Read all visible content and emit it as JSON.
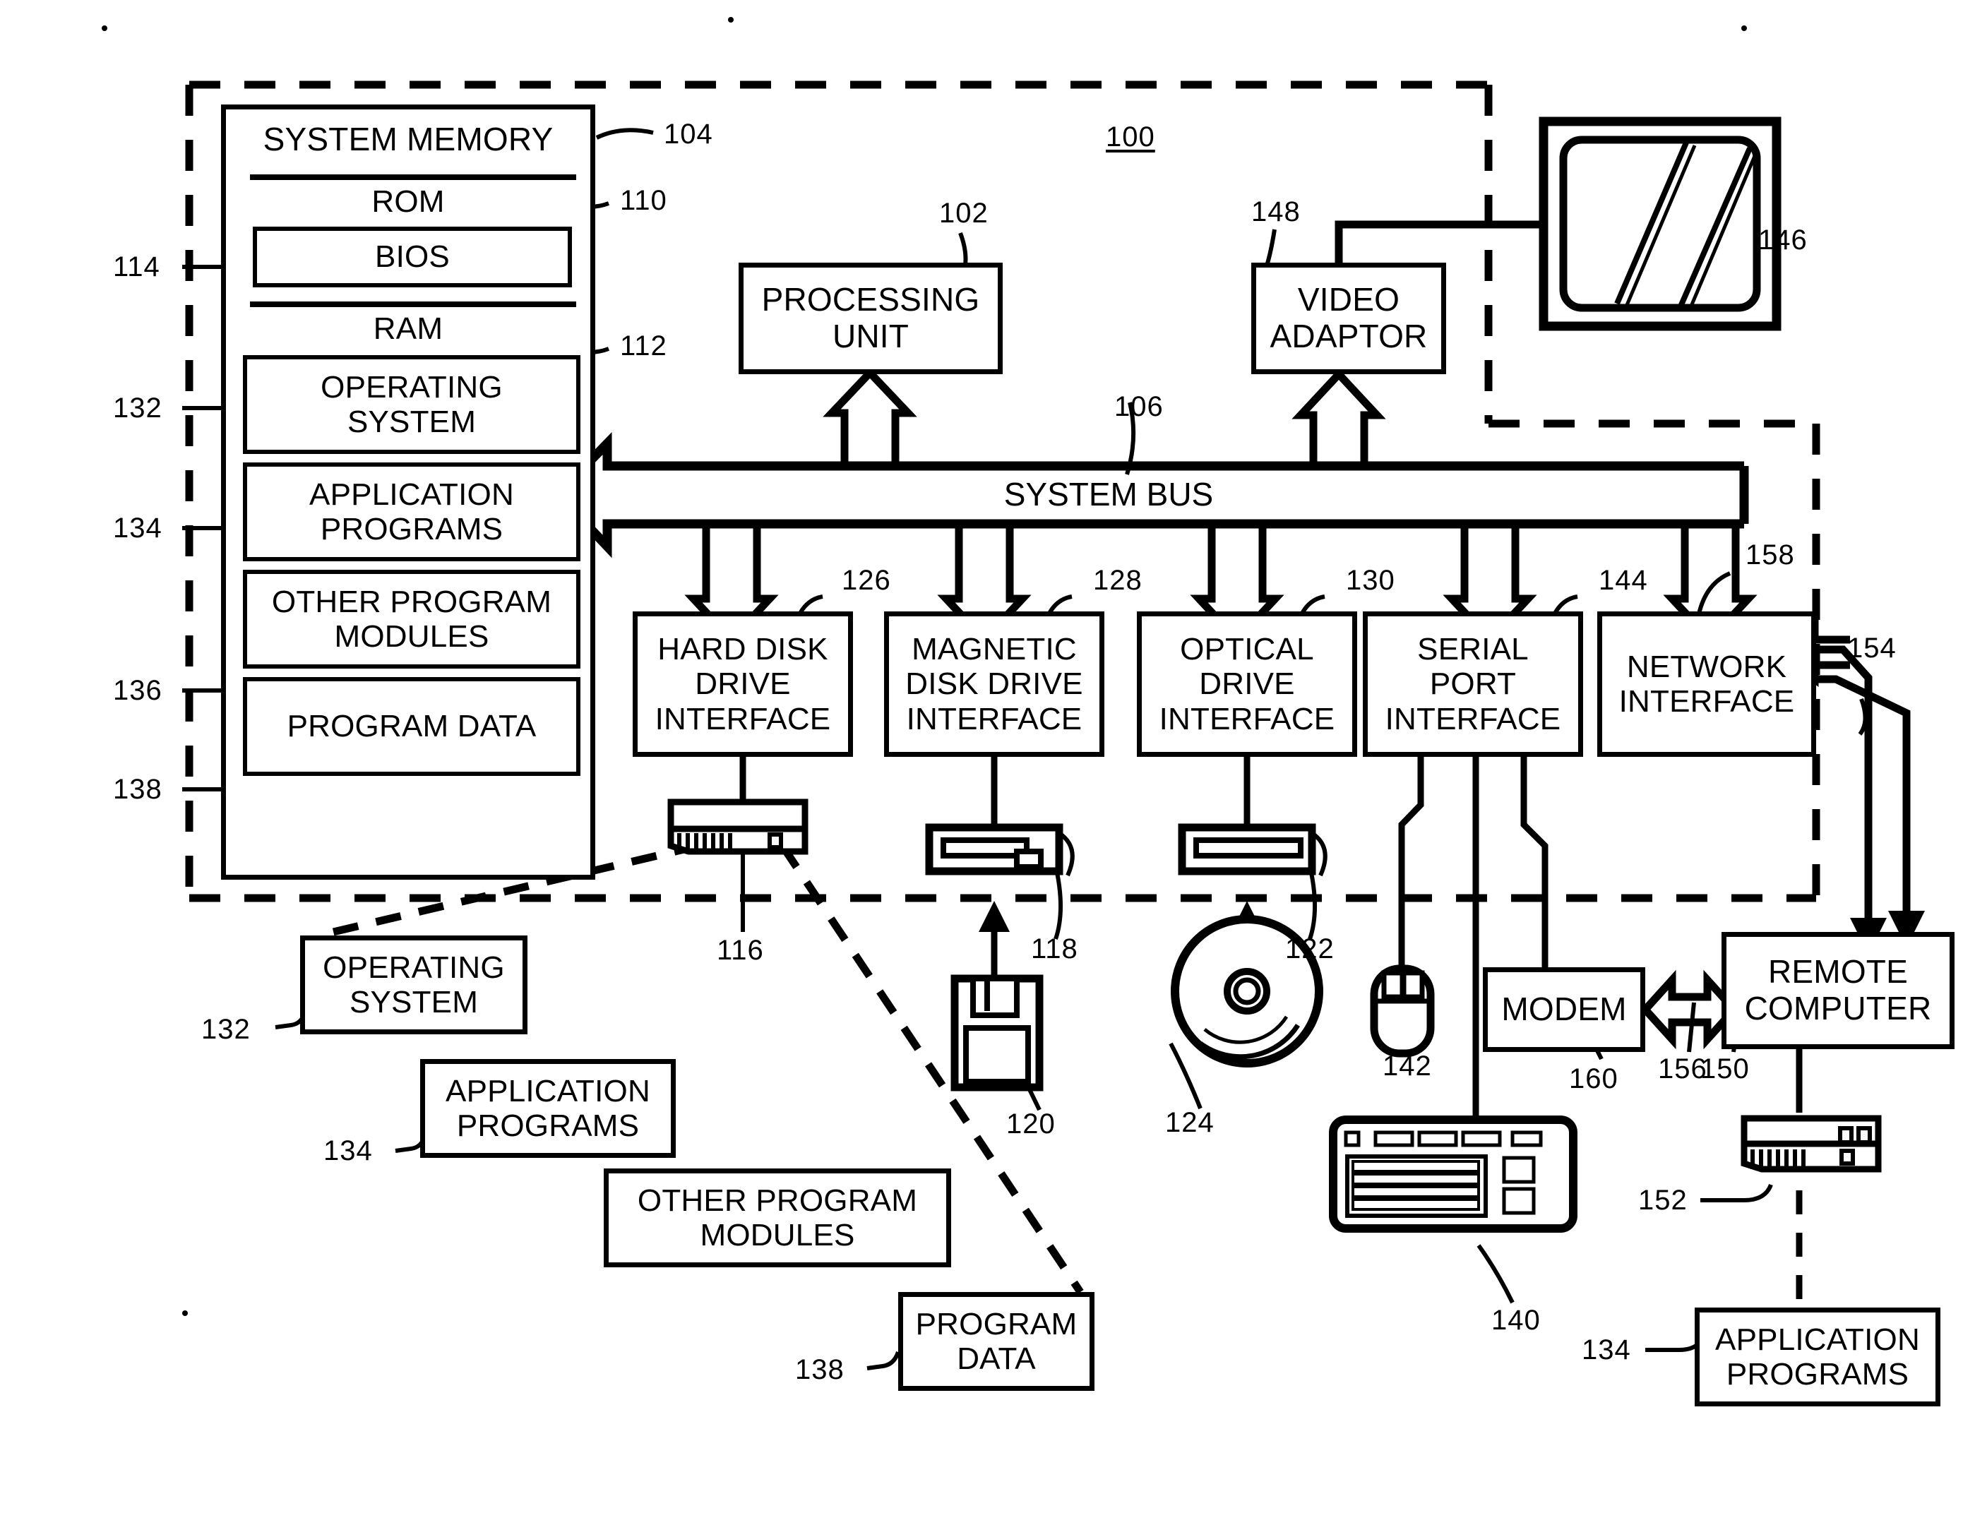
{
  "figure": {
    "id": "100",
    "system_memory": {
      "title": "SYSTEM MEMORY",
      "rom_label": "ROM",
      "bios_label": "BIOS",
      "ram_label": "RAM",
      "blocks": [
        "OPERATING SYSTEM",
        "APPLICATION PROGRAMS",
        "OTHER PROGRAM MODULES",
        "PROGRAM DATA"
      ]
    },
    "processing_unit": "PROCESSING UNIT",
    "video_adaptor": "VIDEO ADAPTOR",
    "system_bus": "SYSTEM BUS",
    "interfaces": [
      "HARD DISK DRIVE INTERFACE",
      "MAGNETIC DISK DRIVE INTERFACE",
      "OPTICAL DRIVE INTERFACE",
      "SERIAL PORT INTERFACE",
      "NETWORK INTERFACE"
    ],
    "stored_modules": [
      "OPERATING SYSTEM",
      "APPLICATION PROGRAMS",
      "OTHER PROGRAM MODULES",
      "PROGRAM DATA"
    ],
    "modem": "MODEM",
    "remote_computer": "REMOTE COMPUTER",
    "remote_application_programs": "APPLICATION PROGRAMS",
    "reference_numerals": {
      "n100": "100",
      "n102": "102",
      "n104": "104",
      "n106": "106",
      "n110": "110",
      "n112": "112",
      "n114": "114",
      "n116": "116",
      "n118": "118",
      "n120": "120",
      "n122": "122",
      "n124": "124",
      "n126": "126",
      "n128": "128",
      "n130": "130",
      "n132_mem": "132",
      "n132_disk": "132",
      "n134_mem": "134",
      "n134_disk": "134",
      "n134_remote": "134",
      "n136_mem": "136",
      "n138_mem": "138",
      "n138_disk": "138",
      "n140": "140",
      "n142": "142",
      "n144": "144",
      "n146": "146",
      "n148": "148",
      "n150": "150",
      "n152": "152",
      "n154": "154",
      "n156": "156",
      "n158": "158",
      "n160": "160"
    },
    "icons": {
      "monitor": "monitor-icon",
      "hard_disk_drive": "hard-disk-drive-icon",
      "magnetic_disk_drive": "magnetic-disk-drive-icon",
      "floppy_disk": "floppy-disk-icon",
      "optical_drive": "optical-drive-icon",
      "optical_disc": "optical-disc-icon",
      "mouse": "mouse-icon",
      "keyboard": "keyboard-icon",
      "remote_hard_disk": "remote-hard-disk-icon"
    },
    "colors": {
      "ink": "#000000",
      "paper": "#ffffff"
    }
  }
}
